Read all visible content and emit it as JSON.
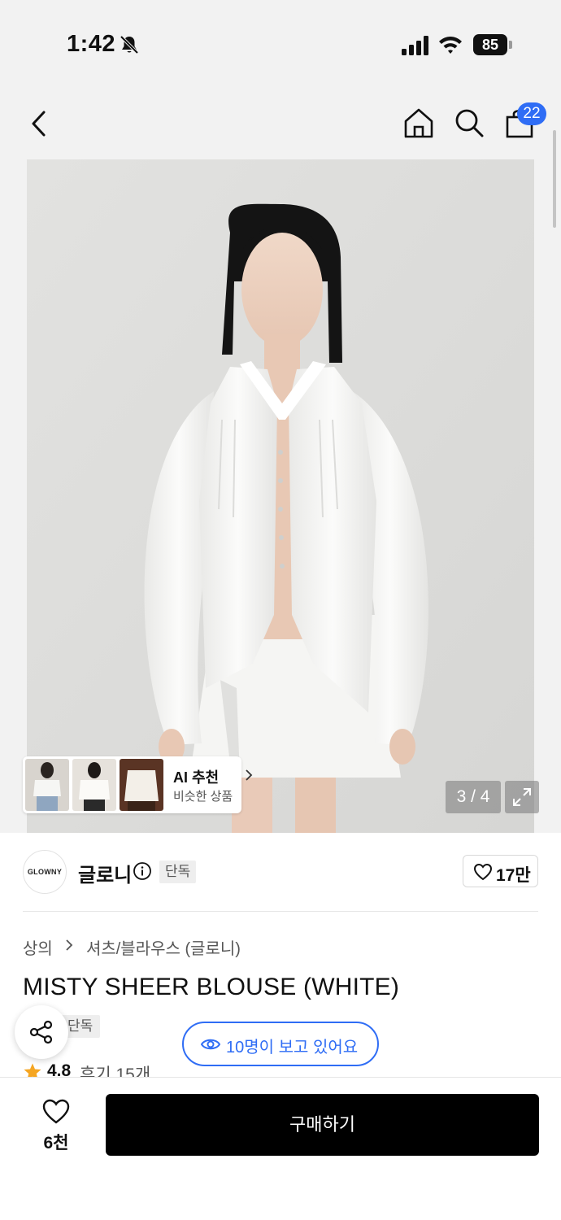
{
  "status_bar": {
    "time": "1:42",
    "battery": "85"
  },
  "nav": {
    "cart_count": "22"
  },
  "gallery": {
    "page_indicator": "3 / 4",
    "ai_title": "AI 추천",
    "ai_subtitle": "비슷한 상품"
  },
  "brand": {
    "logo_text": "GLOWNY",
    "name": "글로니",
    "tag": "단독",
    "like_count": "17만"
  },
  "product": {
    "breadcrumb": [
      "상의",
      "셔츠/블라우스 (글로니)"
    ],
    "title": "MISTY SHEER BLOUSE (WHITE)",
    "tag": "단독",
    "viewers": "10명이 보고 있어요",
    "rating": "4.8",
    "reviews": "후기 15개"
  },
  "bottom_bar": {
    "wish_count": "6천",
    "buy_label": "구매하기"
  },
  "colors": {
    "accent": "#2f6df5",
    "star": "#f5a623",
    "buy_button": "#000000"
  }
}
